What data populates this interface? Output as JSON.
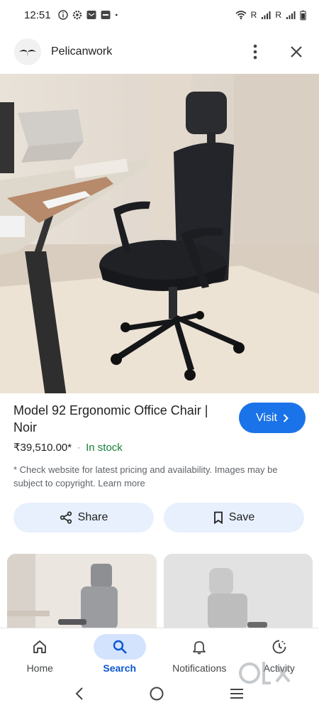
{
  "status_bar": {
    "time": "12:51",
    "signal_text_1": "R",
    "signal_text_2": "R"
  },
  "header": {
    "site_name": "Pelicanwork"
  },
  "product": {
    "title": "Model 92 Ergonomic Office Chair | Noir",
    "visit_label": "Visit",
    "price": "₹39,510.00*",
    "separator": "·",
    "stock": "In stock",
    "disclaimer": "* Check website for latest pricing and availability. Images may be subject to copyright. Learn more"
  },
  "actions": {
    "share_label": "Share",
    "save_label": "Save"
  },
  "bottom_nav": {
    "items": [
      {
        "label": "Home",
        "icon": "home-icon"
      },
      {
        "label": "Search",
        "icon": "search-icon",
        "active": true
      },
      {
        "label": "Notifications",
        "icon": "bell-icon"
      },
      {
        "label": "Activity",
        "icon": "activity-icon"
      }
    ]
  },
  "colors": {
    "accent": "#1a73e8",
    "stock": "#188038",
    "pill_bg": "#e8f0fe",
    "nav_active_bg": "#d3e3fd"
  }
}
